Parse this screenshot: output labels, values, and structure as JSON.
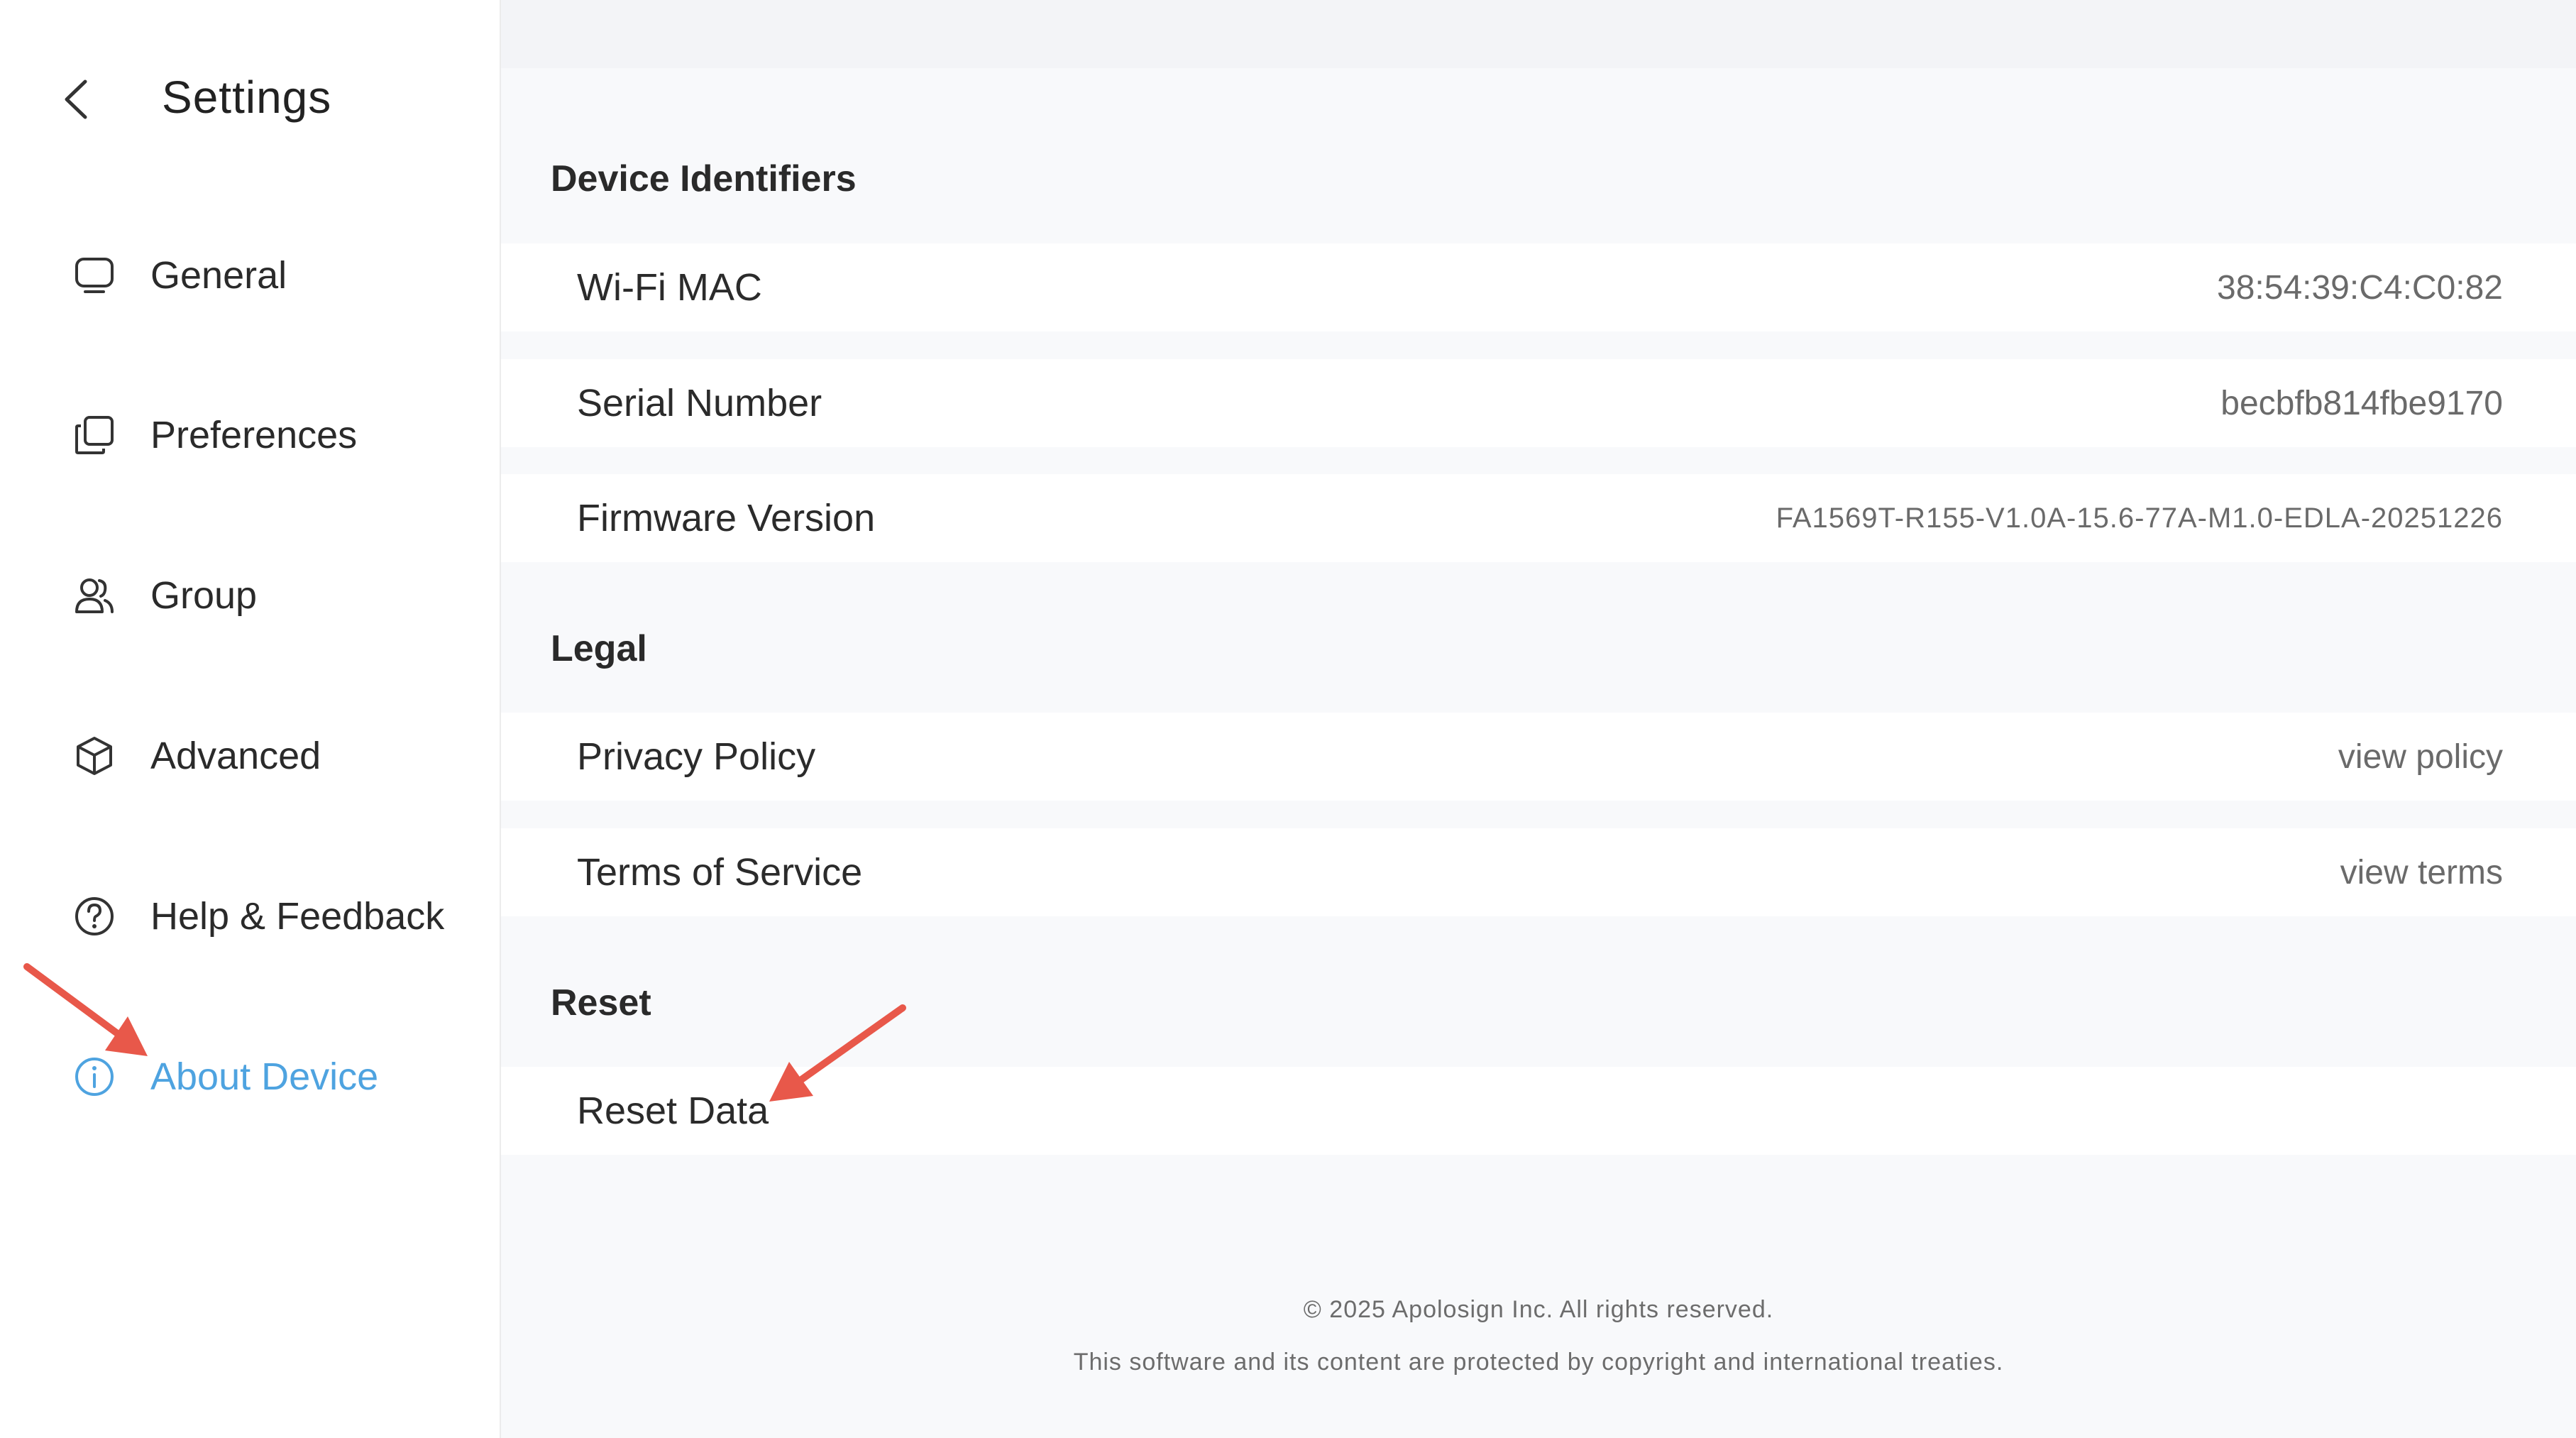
{
  "header": {
    "title": "Settings"
  },
  "sidebar": {
    "items": [
      {
        "label": "General",
        "icon": "monitor-icon",
        "active": false
      },
      {
        "label": "Preferences",
        "icon": "copy-icon",
        "active": false
      },
      {
        "label": "Group",
        "icon": "users-icon",
        "active": false
      },
      {
        "label": "Advanced",
        "icon": "cube-icon",
        "active": false
      },
      {
        "label": "Help & Feedback",
        "icon": "help-circle-icon",
        "active": false
      },
      {
        "label": "About Device",
        "icon": "info-circle-icon",
        "active": true
      }
    ],
    "active_color": "#4ea3e0"
  },
  "main": {
    "sections": {
      "identifiers": {
        "title": "Device Identifiers",
        "rows": [
          {
            "label": "Wi-Fi MAC",
            "value": "38:54:39:C4:C0:82"
          },
          {
            "label": "Serial Number",
            "value": "becbfb814fbe9170"
          },
          {
            "label": "Firmware Version",
            "value": "FA1569T-R155-V1.0A-15.6-77A-M1.0-EDLA-20251226"
          }
        ]
      },
      "legal": {
        "title": "Legal",
        "rows": [
          {
            "label": "Privacy Policy",
            "value": "view policy"
          },
          {
            "label": "Terms of Service",
            "value": "view terms"
          }
        ]
      },
      "reset": {
        "title": "Reset",
        "rows": [
          {
            "label": "Reset Data"
          }
        ]
      }
    }
  },
  "footer": {
    "copyright": "© 2025 Apolosign Inc. All rights reserved.",
    "notice": "This software and its content are protected by copyright and international treaties."
  },
  "annotation_color": "#e8584a"
}
